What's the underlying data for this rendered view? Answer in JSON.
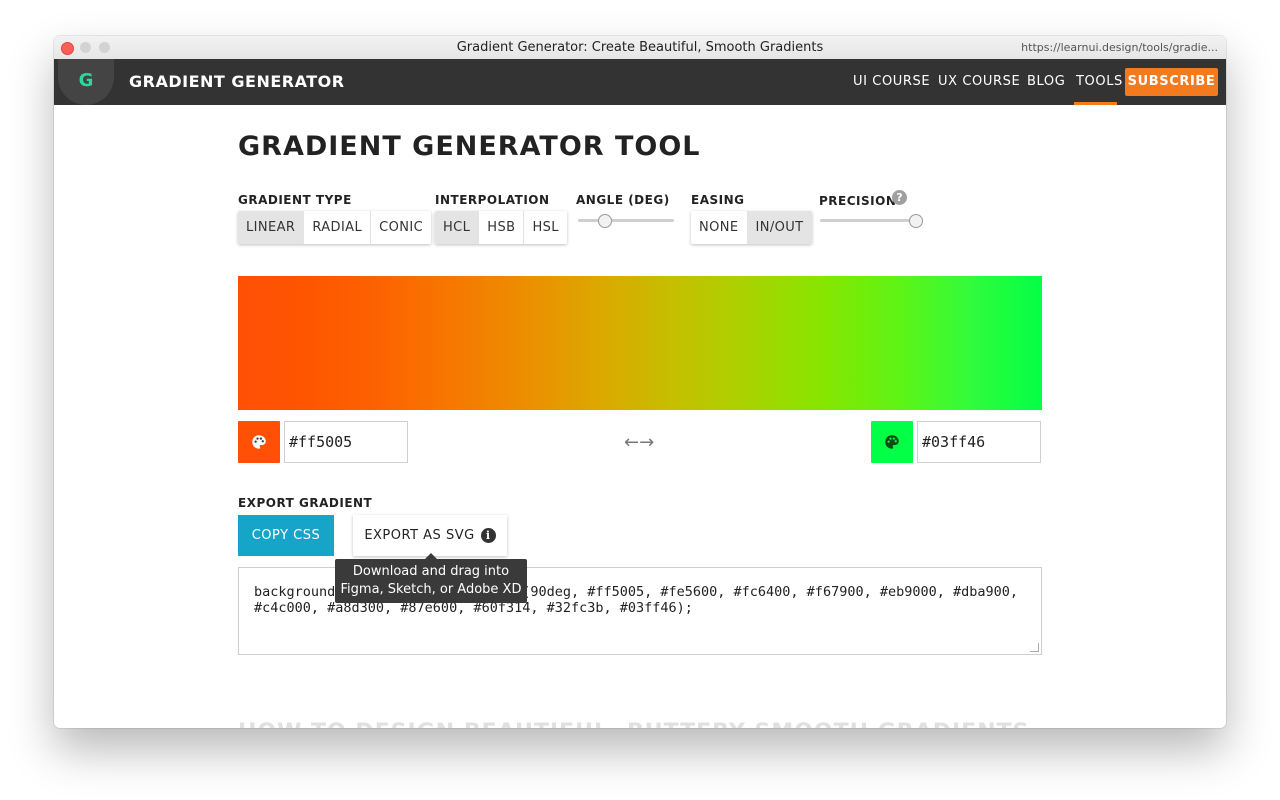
{
  "window": {
    "title": "Gradient Generator: Create Beautiful, Smooth Gradients",
    "url": "https://learnui.design/tools/gradie..."
  },
  "nav": {
    "brand": "GRADIENT GENERATOR",
    "logo_letter": "G",
    "links": [
      "UI COURSE",
      "UX COURSE",
      "BLOG",
      "TOOLS"
    ],
    "active_link": "TOOLS",
    "subscribe_label": "SUBSCRIBE",
    "accent_color": "#f47a1f"
  },
  "page": {
    "title": "GRADIENT GENERATOR TOOL"
  },
  "controls": {
    "gradient_type": {
      "label": "GRADIENT TYPE",
      "options": [
        "LINEAR",
        "RADIAL",
        "CONIC"
      ],
      "selected": "LINEAR"
    },
    "interpolation": {
      "label": "INTERPOLATION",
      "options": [
        "HCL",
        "HSB",
        "HSL"
      ],
      "selected": "HCL"
    },
    "angle": {
      "label": "ANGLE (DEG)",
      "value_fraction": 0.28
    },
    "easing": {
      "label": "EASING",
      "options": [
        "NONE",
        "IN/OUT"
      ],
      "selected": "IN/OUT"
    },
    "precision": {
      "label": "PRECISION",
      "value_fraction": 1.0
    }
  },
  "gradient": {
    "start_color": "#ff5005",
    "end_color": "#03ff46",
    "start_hex": "#ff5005",
    "end_hex": "#03ff46",
    "swap_icon": "←→"
  },
  "export": {
    "label": "EXPORT GRADIENT",
    "copy_css_label": "COPY CSS",
    "export_svg_label": "EXPORT AS SVG",
    "copy_css_color": "#16a4c9",
    "tooltip_line1": "Download and drag into",
    "tooltip_line2": "Figma, Sketch, or Adobe XD",
    "css_line1": "background-image: linear-gradient(90deg, #ff5005, #fe5600, #fc6400, #f67900, #eb9000, #dba900,",
    "css_line2": "#c4c000, #a8d300, #87e600, #60f314, #32fc3b, #03ff46);"
  },
  "below_fold_heading": "HOW TO DESIGN BEAUTIFUL, BUTTERY SMOOTH GRADIENTS"
}
